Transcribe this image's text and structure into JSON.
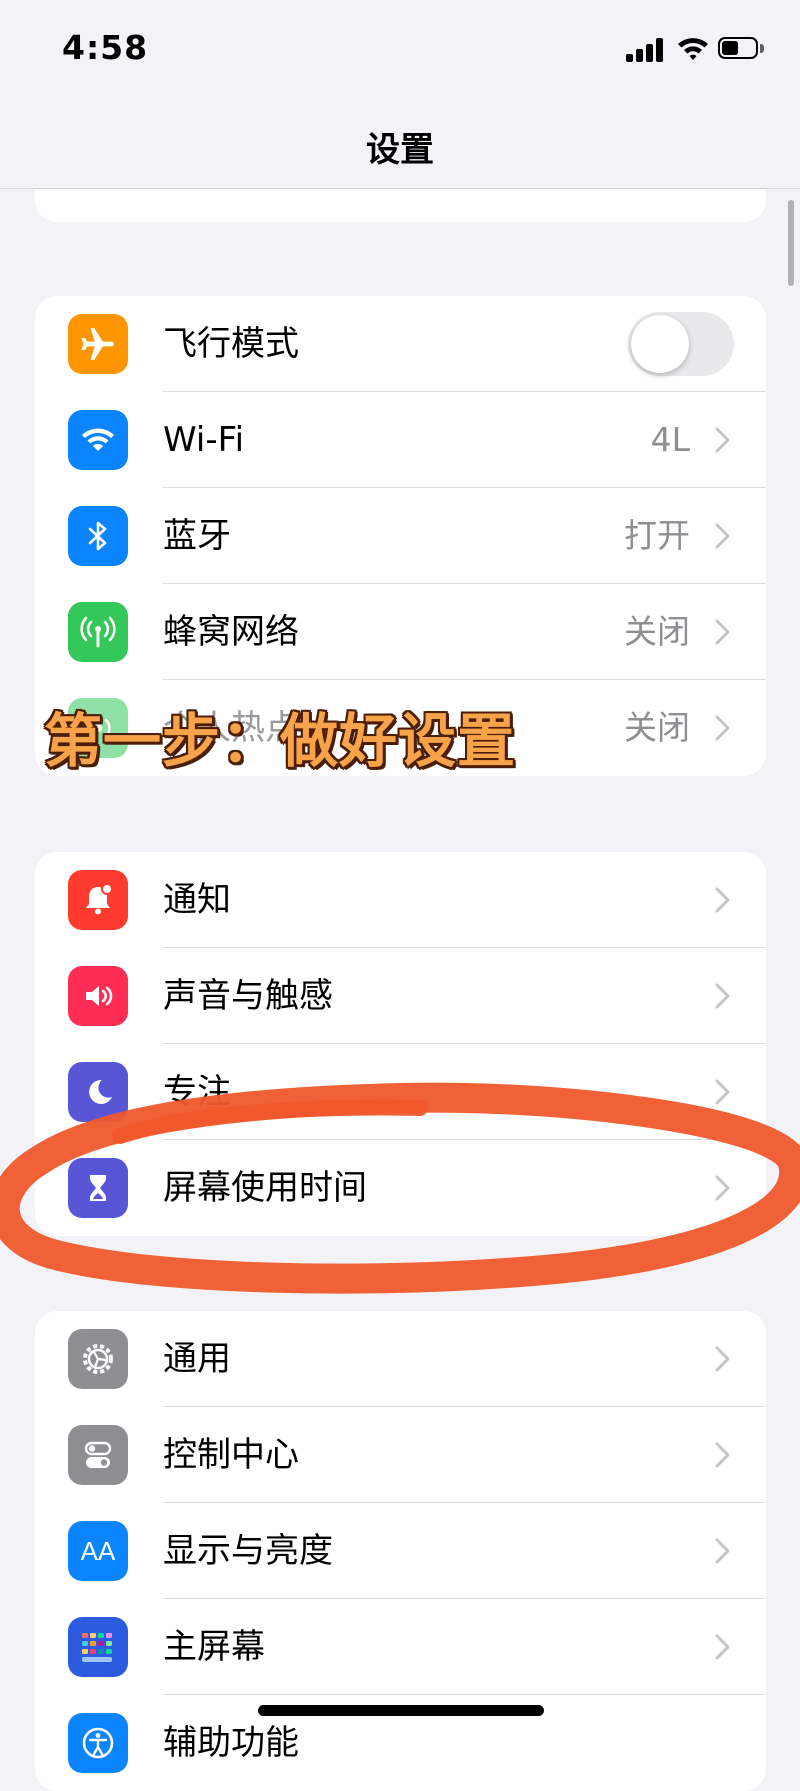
{
  "status_bar": {
    "time": "4:58"
  },
  "nav": {
    "title": "设置"
  },
  "groups": {
    "connectivity": [
      {
        "label": "飞行模式",
        "icon": "airplane-icon",
        "color": "#ff9500",
        "toggle": false
      },
      {
        "label": "Wi-Fi",
        "value": "4L",
        "icon": "wifi-icon",
        "color": "#0a84ff"
      },
      {
        "label": "蓝牙",
        "value": "打开",
        "icon": "bluetooth-icon",
        "color": "#0a84ff"
      },
      {
        "label": "蜂窝网络",
        "value": "关闭",
        "icon": "antenna-icon",
        "color": "#34c759"
      },
      {
        "label": "个人热点",
        "value": "关闭",
        "icon": "hotspot-icon",
        "color": "#34c759"
      }
    ],
    "notifications": [
      {
        "label": "通知",
        "icon": "bell-icon",
        "color": "#ff3b30"
      },
      {
        "label": "声音与触感",
        "icon": "speaker-icon",
        "color": "#ff2d55"
      },
      {
        "label": "专注",
        "icon": "moon-icon",
        "color": "#5856d6"
      },
      {
        "label": "屏幕使用时间",
        "icon": "hourglass-icon",
        "color": "#5856d6"
      }
    ],
    "general": [
      {
        "label": "通用",
        "icon": "gear-icon",
        "color": "#8e8e93"
      },
      {
        "label": "控制中心",
        "icon": "switches-icon",
        "color": "#8e8e93"
      },
      {
        "label": "显示与亮度",
        "icon": "text-size-icon",
        "icon_text": "AA",
        "color": "#0a84ff"
      },
      {
        "label": "主屏幕",
        "icon": "home-grid-icon",
        "color": "#2c5be0"
      },
      {
        "label": "辅助功能",
        "icon": "accessibility-icon",
        "color": "#0a84ff"
      }
    ]
  },
  "overlay": {
    "caption": "第一步：做好设置",
    "highlight_color": "#f0582c"
  }
}
